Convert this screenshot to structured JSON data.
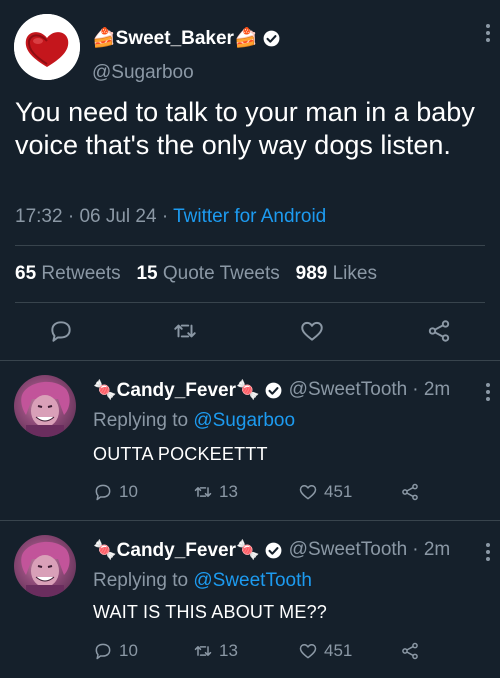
{
  "main_tweet": {
    "display_name": "🍰Sweet_Baker🍰",
    "handle": "@Sugarboo",
    "text": "You need to talk to your man in a baby voice that's the only way dogs listen.",
    "time": "17:32",
    "date": "06 Jul 24",
    "source": "Twitter for Android",
    "separator": "·",
    "retweets_count": "65",
    "retweets_label": "Retweets",
    "quotes_count": "15",
    "quotes_label": "Quote Tweets",
    "likes_count": "989",
    "likes_label": "Likes"
  },
  "replies": [
    {
      "display_name": "🍬Candy_Fever🍬",
      "handle": "@SweetTooth",
      "age": "· 2m",
      "replying_prefix": "Replying to",
      "replying_to": "@Sugarboo",
      "text": "OUTTA POCKEETTT",
      "replies": "10",
      "retweets": "13",
      "likes": "451"
    },
    {
      "display_name": "🍬Candy_Fever🍬",
      "handle": "@SweetTooth",
      "age": "· 2m",
      "replying_prefix": "Replying to",
      "replying_to": "@SweetTooth",
      "text": "WAIT IS THIS ABOUT ME??",
      "replies": "10",
      "retweets": "13",
      "likes": "451"
    }
  ],
  "colors": {
    "background": "#15202b",
    "muted": "#8b98a5",
    "link": "#1d9bf0",
    "divider": "#38444d"
  },
  "icons": [
    "more-icon",
    "verified-icon",
    "reply-icon",
    "retweet-icon",
    "like-icon",
    "share-icon"
  ]
}
